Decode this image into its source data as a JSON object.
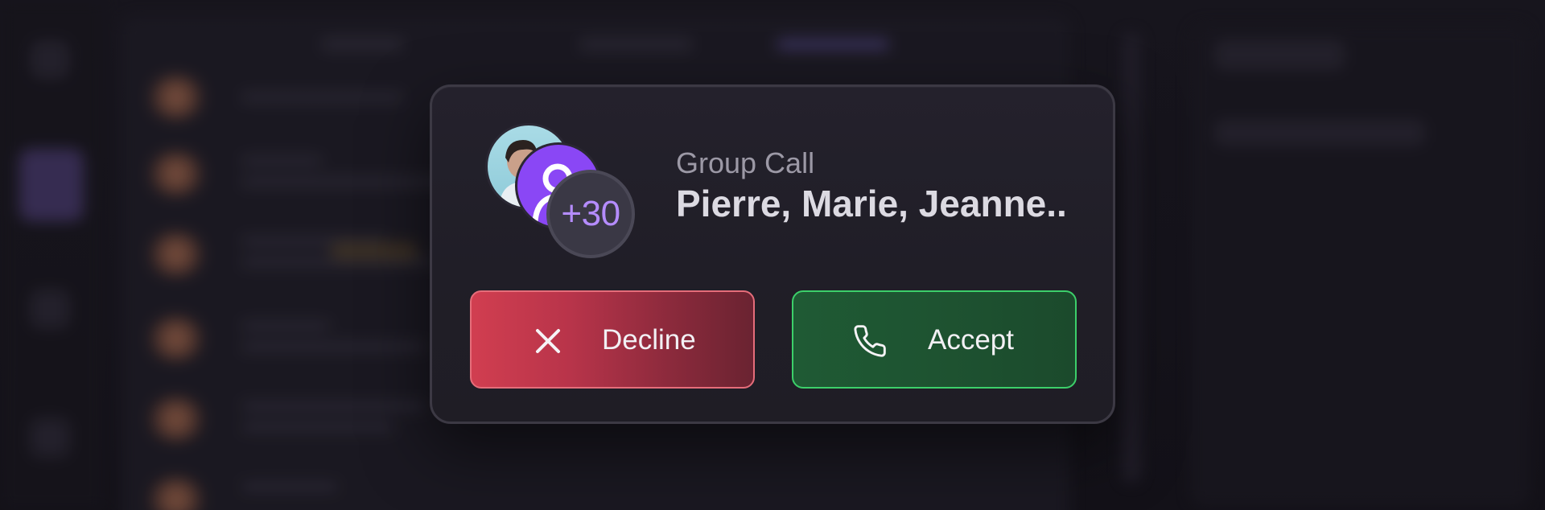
{
  "call": {
    "type_label": "Group Call",
    "participants": "Pierre, Marie, Jeanne..",
    "additional_count": "+30"
  },
  "actions": {
    "decline_label": "Decline",
    "accept_label": "Accept"
  },
  "icons": {
    "decline": "close-icon",
    "accept": "phone-icon",
    "default_avatar": "user-icon"
  },
  "colors": {
    "decline": "#d13e50",
    "accept": "#1f5a34",
    "avatar_default": "#8a47f5",
    "count_text": "#b58cff"
  }
}
